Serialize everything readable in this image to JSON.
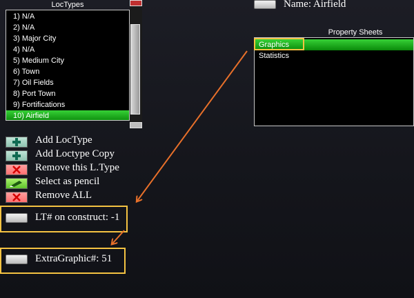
{
  "loctypes_panel": {
    "title": "LocTypes",
    "items": [
      "1) N/A",
      "2) N/A",
      "3) Major City",
      "4) N/A",
      "5) Medium City",
      "6) Town",
      "7) Oil Fields",
      "8) Port Town",
      "9) Fortifications",
      "10) Airfield"
    ],
    "selected_index": 9
  },
  "name_field": {
    "label": "Name: Airfield"
  },
  "property_sheets": {
    "title": "Property Sheets",
    "items": [
      "Graphics",
      "Statistics"
    ],
    "selected_index": 0
  },
  "actions": [
    {
      "label": "Add LocType",
      "icon": "plus-icon"
    },
    {
      "label": "Add Loctype Copy",
      "icon": "plus-icon"
    },
    {
      "label": "Remove this L.Type",
      "icon": "x-icon"
    },
    {
      "label": "Select as pencil",
      "icon": "pencil-icon"
    },
    {
      "label": "Remove ALL",
      "icon": "x-icon"
    }
  ],
  "lt_on_construct": {
    "label": "LT# on construct: -1"
  },
  "extra_graphic": {
    "label": "ExtraGraphic#:  51"
  },
  "colors": {
    "highlight_box": "#f5c342",
    "arrow": "#e8702a",
    "selection_green": "#0a8a0a"
  }
}
